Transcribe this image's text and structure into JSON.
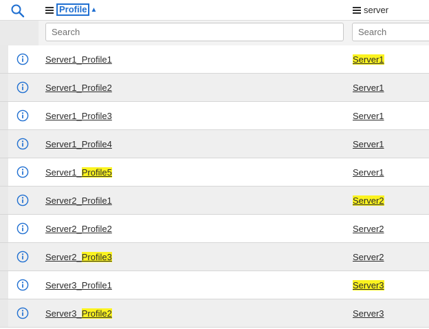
{
  "header": {
    "profile_label": "Profile",
    "profile_sort_icon": "sort-ascending-triangle",
    "server_label": "server",
    "search_icon": "magnifier-icon",
    "menu_icon": "hamburger-icon"
  },
  "filters": {
    "profile_placeholder": "Search",
    "server_placeholder": "Search"
  },
  "colors": {
    "accent": "#1f6fd1",
    "highlight": "#fbf31f",
    "row_alt": "#efefef"
  },
  "rows": [
    {
      "profile_a": "Server1_Profile1",
      "profile_b": "",
      "server": "Server1"
    },
    {
      "profile_a": "Server1_Profile2",
      "profile_b": "",
      "server": "Server1"
    },
    {
      "profile_a": "Server1_Profile3",
      "profile_b": "",
      "server": "Server1"
    },
    {
      "profile_a": "Server1_Profile4",
      "profile_b": "",
      "server": "Server1"
    },
    {
      "profile_a": "Server1_",
      "profile_b": "Profile5",
      "server": "Server1"
    },
    {
      "profile_a": "Server2_Profile1",
      "profile_b": "",
      "server": "Server2"
    },
    {
      "profile_a": "Server2_Profile2",
      "profile_b": "",
      "server": "Server2"
    },
    {
      "profile_a": "Server2_",
      "profile_b": "Profile3",
      "server": "Server2"
    },
    {
      "profile_a": "Server3_Profile1",
      "profile_b": "",
      "server": "Server3"
    },
    {
      "profile_a": "Server3_",
      "profile_b": "Profile2",
      "server": "Server3"
    }
  ]
}
